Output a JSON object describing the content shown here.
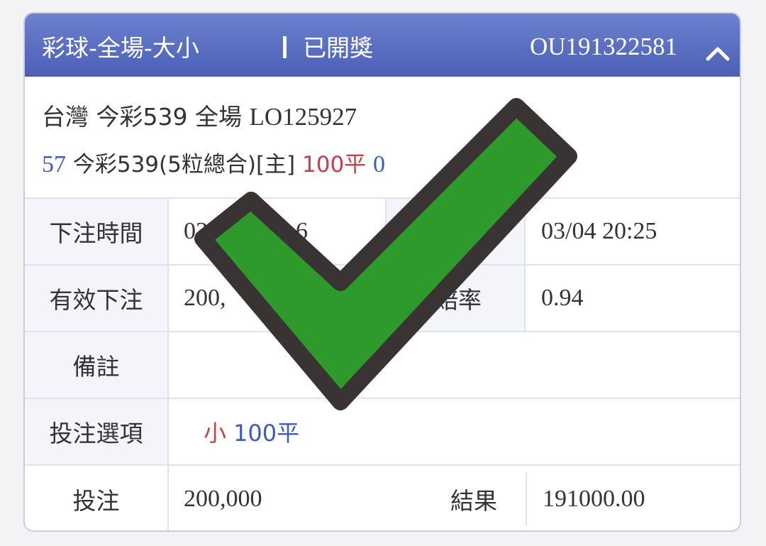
{
  "header": {
    "title": "彩球-全場-大小",
    "status": "已開獎",
    "order_id": "OU191322581"
  },
  "match": {
    "region": "台灣",
    "game": "今彩539",
    "scope": "全場",
    "code": "LO125927",
    "bet_id": "57",
    "bet_desc": "今彩539(5粒總合)[主]",
    "line": "100平",
    "score": "0"
  },
  "details": {
    "bet_time_label": "下注時間",
    "bet_time_value": "03",
    "bet_time_fragment": "6",
    "settle_time_value": "03/04 20:25",
    "valid_bet_label": "有效下注",
    "valid_bet_value": "200,",
    "odds_label": "賠率",
    "odds_value": "0.94",
    "remark_label": "備註",
    "option_label": "投注選項",
    "option_side": "小",
    "option_line": "100平",
    "stake_label": "投注",
    "stake_value": "200,000",
    "result_label": "結果",
    "result_value": "191000.00"
  },
  "overlay": {
    "icon": "checkmark-icon",
    "fill_color": "#2f9a2c",
    "outline_color": "#3a3333"
  }
}
